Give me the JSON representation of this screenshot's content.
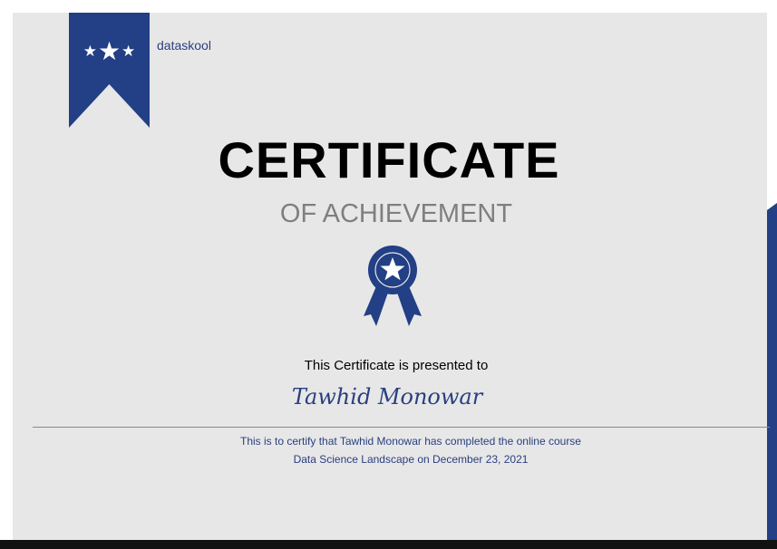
{
  "brand": {
    "name": "dataskool",
    "stars_icon": "three-stars-icon",
    "color": "#233f85"
  },
  "certificate": {
    "title": "CERTIFICATE",
    "subtitle": "OF ACHIEVEMENT",
    "medal_icon": "award-ribbon-icon",
    "presented_label": "This Certificate is presented to",
    "recipient": "Tawhid Monowar",
    "statement_line1": "This is to certify that Tawhid Monowar has completed the online course",
    "statement_line2": "Data Science Landscape on December 23, 2021"
  },
  "colors": {
    "accent": "#233f85",
    "background": "#e7e7e8",
    "subtitle": "#7f7f7f"
  }
}
